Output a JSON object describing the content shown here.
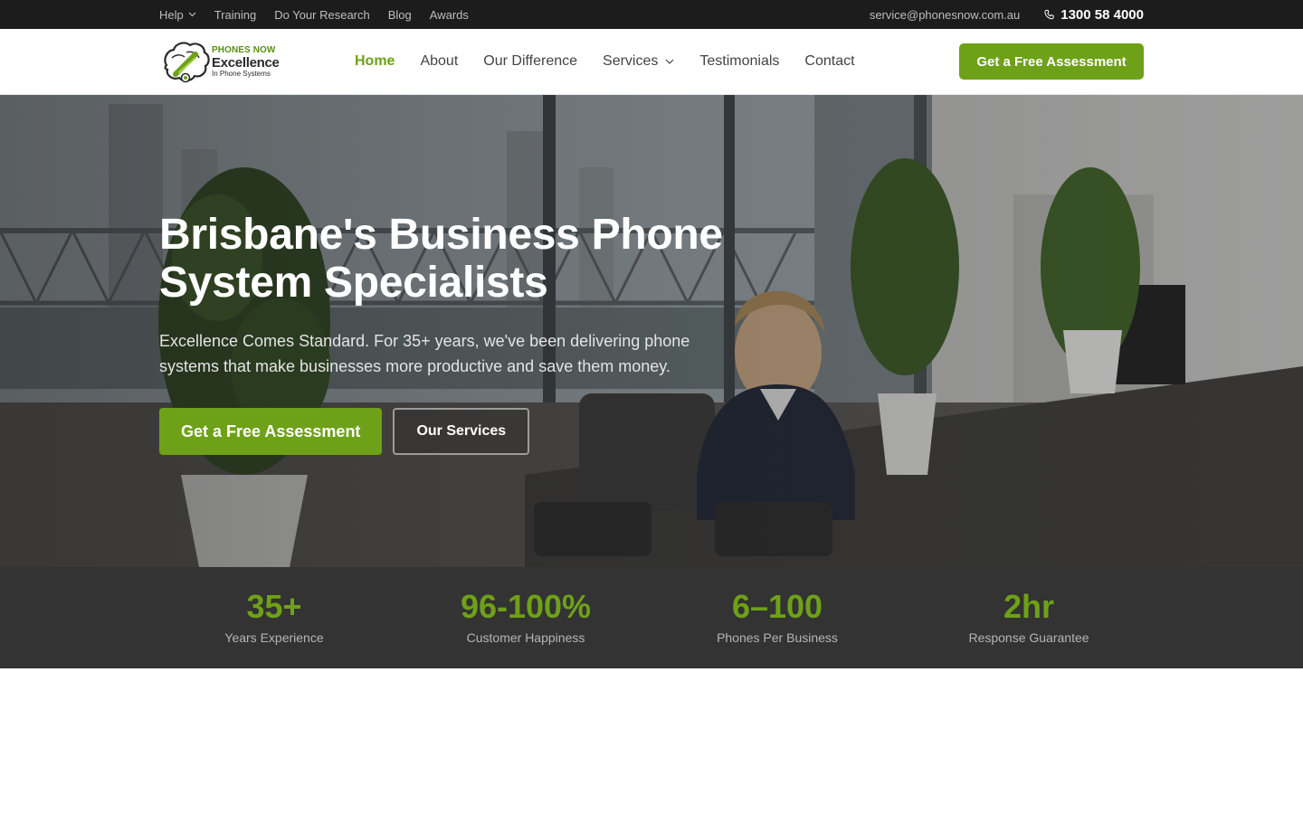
{
  "utility": {
    "links": [
      {
        "label": "Help",
        "has_dropdown": true
      },
      {
        "label": "Training"
      },
      {
        "label": "Do Your Research"
      },
      {
        "label": "Blog"
      },
      {
        "label": "Awards"
      }
    ],
    "email": "service@phonesnow.com.au",
    "phone": "1300 58 4000"
  },
  "header": {
    "logo": {
      "line1": "PHONES NOW",
      "line2": "Excellence",
      "line3": "In Phone Systems"
    },
    "nav": [
      {
        "label": "Home",
        "active": true
      },
      {
        "label": "About"
      },
      {
        "label": "Our Difference"
      },
      {
        "label": "Services",
        "has_dropdown": true
      },
      {
        "label": "Testimonials"
      },
      {
        "label": "Contact"
      }
    ],
    "cta_label": "Get a Free Assessment"
  },
  "hero": {
    "title_line1": "Brisbane's Business Phone",
    "title_line2": "System Specialists",
    "subtitle": "Excellence Comes Standard. For 35+ years, we've been delivering phone systems that make businesses more productive and save them money.",
    "primary_label": "Get a Free Assessment",
    "secondary_label": "Our Services"
  },
  "stats": [
    {
      "value": "35+",
      "label": "Years Experience"
    },
    {
      "value": "96-100%",
      "label": "Customer Happiness"
    },
    {
      "value": "6–100",
      "label": "Phones Per Business"
    },
    {
      "value": "2hr",
      "label": "Response Guarantee"
    }
  ],
  "colors": {
    "accent": "#6ea118",
    "topbar": "#1c1c1c",
    "stats_bg": "#333333"
  },
  "icons": [
    "chevron-down-icon",
    "phone-icon",
    "logo-mark-icon"
  ]
}
